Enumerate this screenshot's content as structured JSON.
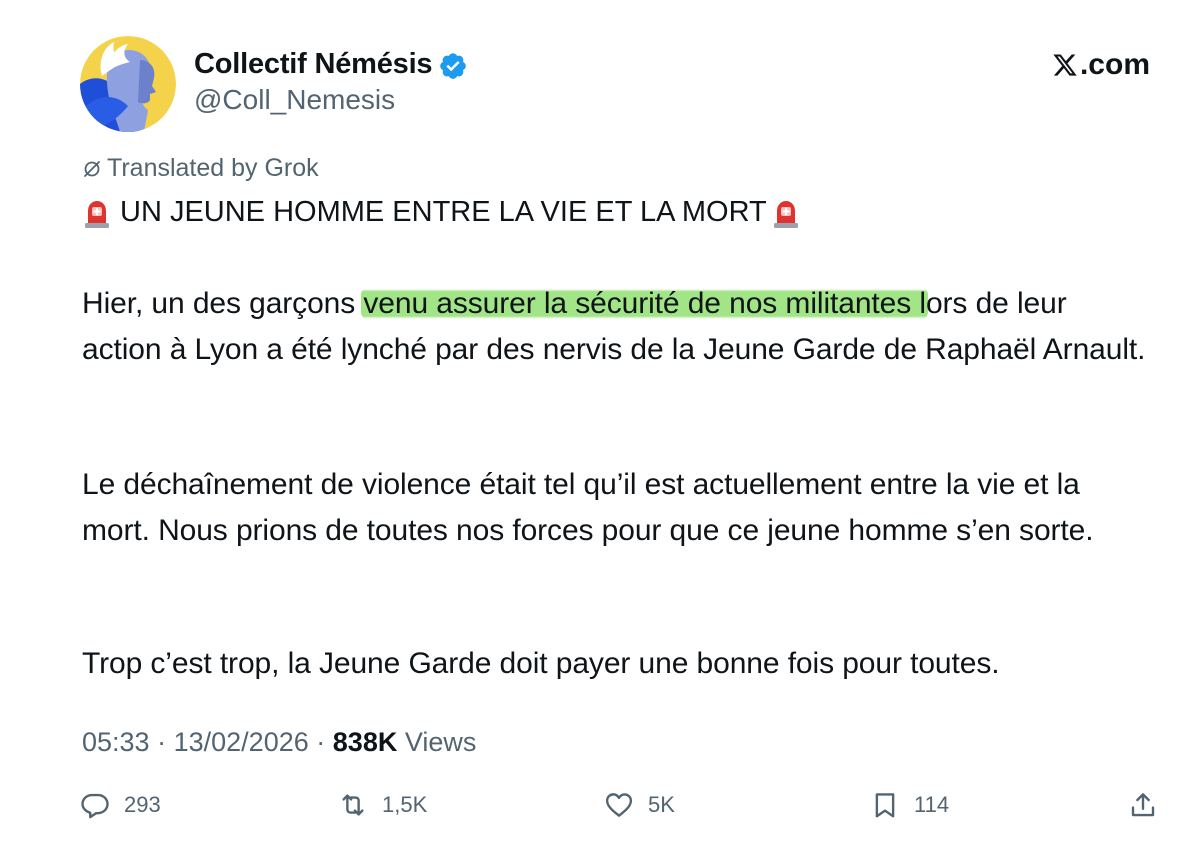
{
  "author": {
    "display_name": "Collectif Némésis",
    "handle": "@Coll_Nemesis",
    "verified": true,
    "avatar_icon": "winged-woman-profile-avatar"
  },
  "brand": {
    "label": ".com",
    "logo_icon": "x-logo-icon"
  },
  "translation": {
    "label": "Translated by Grok",
    "icon": "grok-icon"
  },
  "post": {
    "headline": "UN JEUNE HOMME ENTRE LA VIE ET LA MORT",
    "headline_icon": "police-siren-emoji",
    "p1_before": "Hier, un des garçons ",
    "p1_highlight": "venu assurer la sécurité de nos militantes l",
    "p1_after": "ors de leur action à Lyon a été lynché par des nervis de la Jeune Garde de Raphaël Arnault.",
    "p2": "Le déchaînement de violence était tel qu’il est actuellement entre la vie et la mort. Nous prions de toutes nos forces pour que ce jeune homme s’en sorte.",
    "p3": "Trop c’est trop, la Jeune Garde doit payer une bonne fois pour toutes."
  },
  "meta": {
    "time": "05:33",
    "date": "13/02/2026",
    "separator": "·",
    "views_count": "838K",
    "views_label": "Views"
  },
  "actions": {
    "replies": "293",
    "reposts": "1,5K",
    "likes": "5K",
    "bookmarks": "114"
  },
  "colors": {
    "text_primary": "#0f1419",
    "text_secondary": "#536471",
    "verified_blue": "#1d9bf0",
    "highlight_green": "#87de64",
    "siren_red": "#e0332f"
  }
}
